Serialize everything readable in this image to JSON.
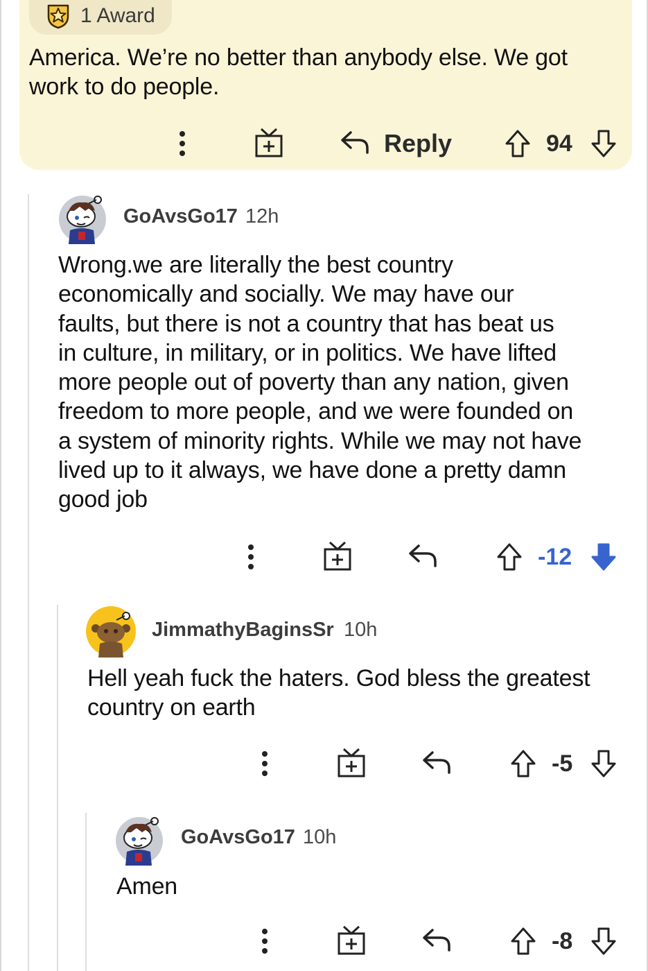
{
  "colors": {
    "highlight_bg": "#fbf5d7",
    "award_pill_bg": "#efe7c6",
    "downvote_active": "#3764cf",
    "text": "#111111"
  },
  "top_comment": {
    "award_icon": "award-star-icon",
    "award_label": "1 Award",
    "body_lines": [
      "America. We’re no better than anybody else. We got",
      "work to do people."
    ],
    "actions": {
      "more_icon": "more-vertical-icon",
      "gift_icon": "gift-icon",
      "reply_icon": "reply-arrow-icon",
      "reply_label": "Reply",
      "upvote_icon": "upvote-arrow-icon",
      "score": "94",
      "downvote_icon": "downvote-arrow-icon"
    }
  },
  "comments": [
    {
      "username": "GoAvsGo17",
      "time": "12h",
      "avatar_icon": "snoo-avatar-icon",
      "body_lines": [
        "Wrong.we are literally the best country",
        "economically and socially. We may have our",
        "faults, but there is not a country that has beat us",
        "in culture, in military, or in politics. We have lifted",
        "more people out of poverty than any nation, given",
        "freedom to more people, and we were founded on",
        "a system of minority rights. While we may not have",
        "lived up to it always, we have done a pretty damn",
        "good job"
      ],
      "score": "-12",
      "downvoted": true
    },
    {
      "username": "JimmathyBaginsSr",
      "time": "10h",
      "avatar_icon": "snoo-avatar-icon",
      "body_lines": [
        "Hell yeah fuck the haters. God bless the greatest",
        "country on earth"
      ],
      "score": "-5",
      "downvoted": false
    },
    {
      "username": "GoAvsGo17",
      "time": "10h",
      "avatar_icon": "snoo-avatar-icon",
      "body_lines": [
        "Amen"
      ],
      "score": "-8",
      "downvoted": false
    }
  ]
}
